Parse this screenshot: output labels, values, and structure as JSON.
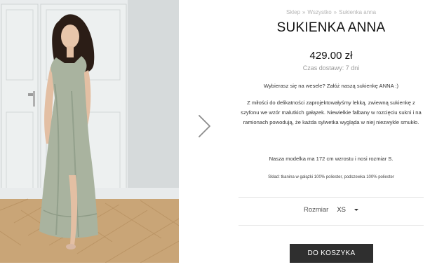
{
  "breadcrumb": {
    "items": [
      "Sklep",
      "Wszystko",
      "Sukienka anna"
    ],
    "separator": "»"
  },
  "product": {
    "title": "SUKIENKA ANNA",
    "price": "429.00 zł",
    "delivery": "Czas dostawy: 7 dni",
    "description_1": "Wybierasz się na wesele? Załóż naszą sukienkę ANNA :)",
    "description_2": "Z miłości do delikatności zaprojektowałyśmy lekką, zwiewną sukienkę z szyfonu we wzór malutkich gałązek. Niewielkie falbany w rozcięciu sukni i na ramionach powodują, że każda sylwetka wygląda w niej niezwykle smukło.",
    "description_3": "Nasza modelka ma 172 cm wzrostu i nosi rozmiar S.",
    "composition": "Skład: tkanina w gałązki 100% poliester, podszewka 100% poliester"
  },
  "size": {
    "label": "Rozmiar",
    "selected": "XS"
  },
  "cart": {
    "button_label": "DO KOSZYKA"
  },
  "icons": {
    "next": "chevron-right-icon",
    "dropdown": "caret-down-icon"
  },
  "colors": {
    "button_bg": "#2f2f2f",
    "muted_text": "#9a9a9a",
    "divider": "#e6e6e6"
  }
}
